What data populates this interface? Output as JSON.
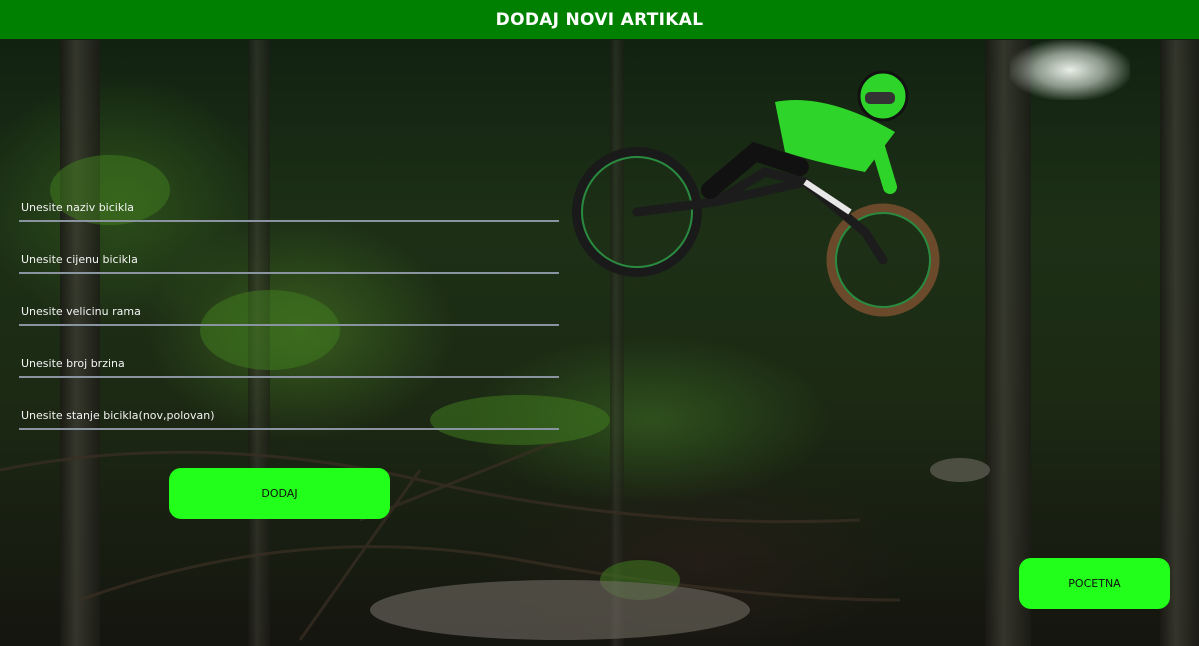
{
  "header": {
    "title": "DODAJ NOVI ARTIKAL"
  },
  "form": {
    "fields": [
      {
        "placeholder": "Unesite naziv bicikla",
        "value": ""
      },
      {
        "placeholder": "Unesite cijenu bicikla",
        "value": ""
      },
      {
        "placeholder": "Unesite velicinu rama",
        "value": ""
      },
      {
        "placeholder": "Unesite broj brzina",
        "value": ""
      },
      {
        "placeholder": "Unesite stanje bicikla(nov,polovan)",
        "value": ""
      }
    ],
    "submit_label": "DODAJ"
  },
  "nav": {
    "home_label": "POCETNA"
  },
  "colors": {
    "header_bg": "#008000",
    "button_bg": "#22ff1a",
    "input_underline": "#8a94a0"
  },
  "background": {
    "icon": "mountain-bike-rider-photo"
  }
}
